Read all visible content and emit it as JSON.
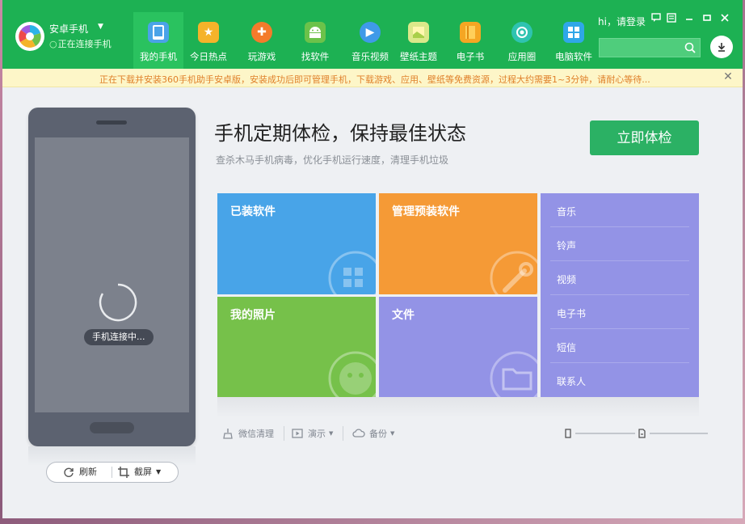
{
  "device": {
    "name": "安卓手机",
    "status": "正在连接手机"
  },
  "nav": [
    {
      "label": "我的手机",
      "icon": "phone-icon",
      "color": "#4aa3e8",
      "active": true
    },
    {
      "label": "今日热点",
      "icon": "star-icon",
      "color": "#f5b32a"
    },
    {
      "label": "玩游戏",
      "icon": "gamepad-icon",
      "color": "#f47b2b"
    },
    {
      "label": "找软件",
      "icon": "android-icon",
      "color": "#6cc24a"
    },
    {
      "label": "音乐视频",
      "icon": "play-icon",
      "color": "#3f9ae8"
    },
    {
      "label": "壁纸主题",
      "icon": "wallpaper-icon",
      "color": "#cfe07a"
    },
    {
      "label": "电子书",
      "icon": "book-icon",
      "color": "#f5a623"
    },
    {
      "label": "应用圈",
      "icon": "circle-icon",
      "color": "#2fc3b0"
    },
    {
      "label": "电脑软件",
      "icon": "windows-icon",
      "color": "#2fa7e8"
    }
  ],
  "header": {
    "login": "hi，请登录",
    "search_placeholder": ""
  },
  "notice": {
    "text": "正在下载并安装360手机助手安卓版，安装成功后即可管理手机，下载游戏、应用、壁纸等免费资源，过程大约需要1~3分钟，请耐心等待..."
  },
  "phone": {
    "connecting": "手机连接中...",
    "refresh": "刷新",
    "screenshot": "截屏"
  },
  "main": {
    "headline": "手机定期体检，保持最佳状态",
    "subline": "查杀木马手机病毒，优化手机运行速度，清理手机垃圾",
    "check_button": "立即体检"
  },
  "tiles": [
    {
      "title": "已装软件",
      "color": "#48a4e8",
      "icon": "apps-icon"
    },
    {
      "title": "管理预装软件",
      "color": "#f59a36",
      "icon": "wrench-icon"
    },
    {
      "title": "我的照片",
      "color": "#76c14a",
      "icon": "photo-icon"
    },
    {
      "title": "文件",
      "color": "#9393e6",
      "icon": "folder-icon"
    }
  ],
  "media": [
    "音乐",
    "铃声",
    "视频",
    "电子书",
    "短信",
    "联系人"
  ],
  "toolbar": {
    "wechat_clean": "微信清理",
    "demo": "演示",
    "backup": "备份"
  }
}
